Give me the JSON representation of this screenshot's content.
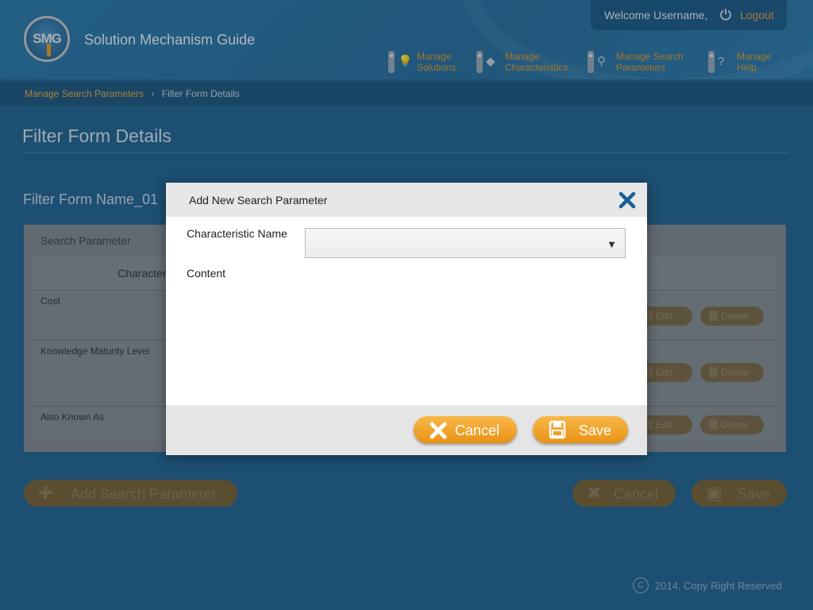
{
  "header": {
    "logo_text": "SMG",
    "app_title": "Solution Mechanism Guide",
    "welcome": "Welcome Username,",
    "logout": "Logout",
    "nav": [
      {
        "line1": "Manage",
        "line2": "Solutions",
        "icon": "lightbulb-icon"
      },
      {
        "line1": "Manage",
        "line2": "Characteristics",
        "icon": "shapes-icon"
      },
      {
        "line1": "Manage Search",
        "line2": "Parameters",
        "icon": "magnifier-icon"
      },
      {
        "line1": "Manage",
        "line2": "Help",
        "icon": "help-icon"
      }
    ]
  },
  "breadcrumb": {
    "parent": "Manage Search Parameters",
    "separator": "›",
    "current": "Filter Form Details"
  },
  "page": {
    "title": "Filter Form Details",
    "form_name": "Filter Form Name_01",
    "panel_title": "Search Parameter",
    "table_header": "Characteristic Name",
    "rows": [
      {
        "label": "Cost",
        "edit": "Edit",
        "delete": "Delete"
      },
      {
        "label": "Knowledge Maturity Level",
        "edit": "Edit",
        "delete": "Delete"
      },
      {
        "label": "Also Known As",
        "edit": "Edit",
        "delete": "Delete"
      }
    ],
    "add_button": "Add Search Parameter",
    "cancel_button": "Cancel",
    "save_button": "Save"
  },
  "footer": {
    "copyright_symbol": "C",
    "copyright": "2014, Copy Right Reserved"
  },
  "modal": {
    "title": "Add New Search Parameter",
    "characteristic_label": "Characteristic Name",
    "characteristic_value": "",
    "content_label": "Content",
    "cancel": "Cancel",
    "save": "Save"
  },
  "colors": {
    "background": "#25658f",
    "accent_orange": "#f0a12a",
    "link_orange": "#e49a2c",
    "close_blue": "#1a5f95"
  }
}
